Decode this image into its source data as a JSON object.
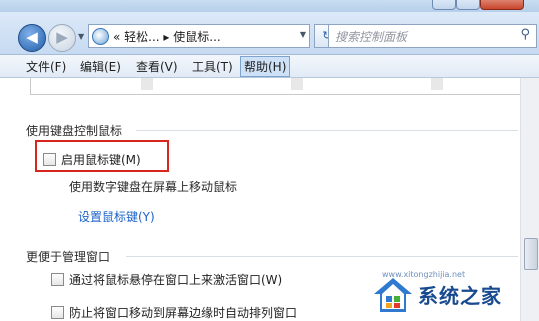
{
  "address": {
    "path": "«  轻松... ▸ 使鼠标..."
  },
  "search": {
    "placeholder": "搜索控制面板"
  },
  "menu": [
    {
      "label": "文件(F)"
    },
    {
      "label": "编辑(E)"
    },
    {
      "label": "查看(V)"
    },
    {
      "label": "工具(T)"
    },
    {
      "label": "帮助(H)"
    }
  ],
  "keyboard_section": {
    "title": "使用键盘控制鼠标",
    "checkbox_label": "启用鼠标键(M)",
    "checked": false,
    "description": "使用数字键盘在屏幕上移动鼠标",
    "link": "设置鼠标键(Y)"
  },
  "window_section": {
    "title": "更便于管理窗口",
    "options": [
      {
        "label": "通过将鼠标悬停在窗口上来激活窗口(W)",
        "checked": false
      },
      {
        "label": "防止将窗口移动到屏幕边缘时自动排列窗口",
        "checked": false
      }
    ]
  },
  "watermark": {
    "text": "系统之家",
    "url": "www.xitongzhijia.net"
  },
  "colors": {
    "highlight": "#d9261c",
    "link": "#1c62c9"
  }
}
